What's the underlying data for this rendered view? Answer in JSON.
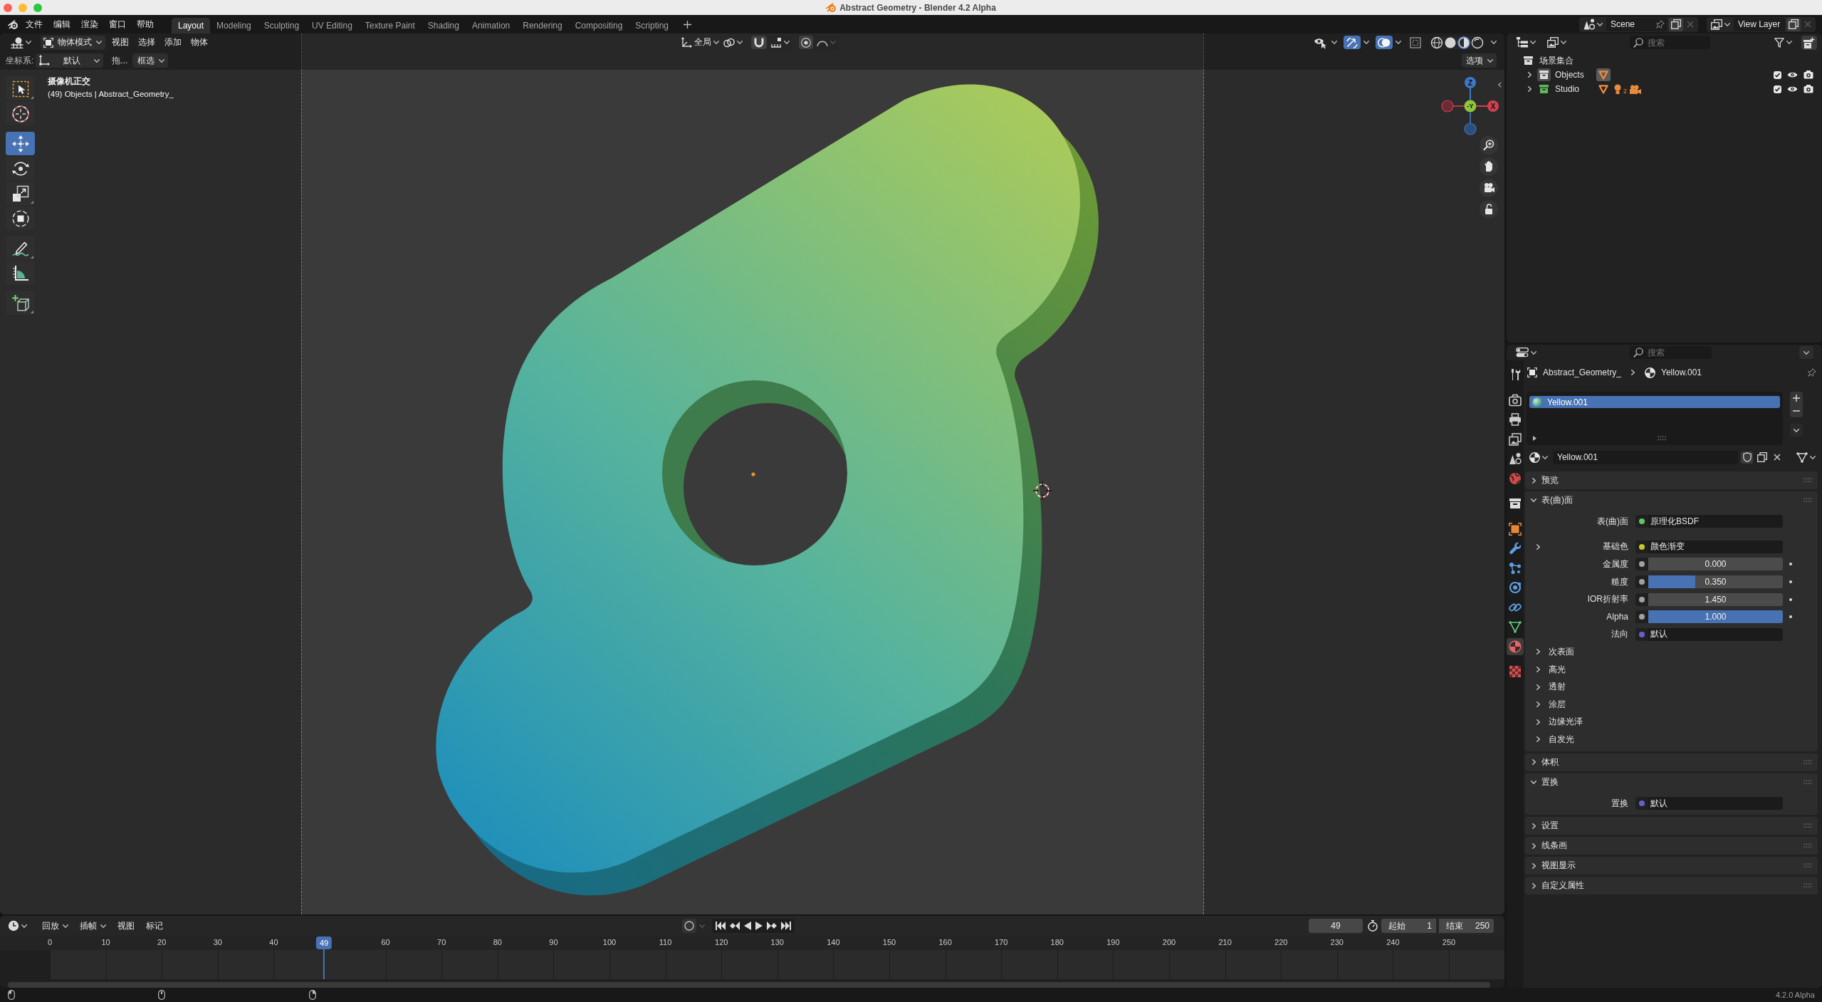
{
  "title_bar": {
    "title": "Abstract Geometry - Blender 4.2 Alpha"
  },
  "top_bar": {
    "menus": [
      "文件",
      "编辑",
      "渲染",
      "窗口",
      "帮助"
    ],
    "workspaces": [
      {
        "label": "Layout",
        "selected": true
      },
      {
        "label": "Modeling",
        "selected": false
      },
      {
        "label": "Sculpting",
        "selected": false
      },
      {
        "label": "UV Editing",
        "selected": false
      },
      {
        "label": "Texture Paint",
        "selected": false
      },
      {
        "label": "Shading",
        "selected": false
      },
      {
        "label": "Animation",
        "selected": false
      },
      {
        "label": "Rendering",
        "selected": false
      },
      {
        "label": "Compositing",
        "selected": false
      },
      {
        "label": "Scripting",
        "selected": false
      }
    ],
    "scene": "Scene",
    "view_layer": "View Layer"
  },
  "viewport": {
    "header": {
      "mode": "物体模式",
      "menus": [
        "视图",
        "选择",
        "添加",
        "物体"
      ],
      "orientation": "全局",
      "toggles": [
        {
          "kind": "visibility",
          "on": false
        },
        {
          "kind": "gizmo",
          "on": true
        },
        {
          "kind": "overlay",
          "on": true
        },
        {
          "kind": "xray",
          "on": false
        }
      ],
      "shading": [
        {
          "kind": "wireframe",
          "selected": false
        },
        {
          "kind": "solid",
          "selected": false
        },
        {
          "kind": "material",
          "selected": true
        },
        {
          "kind": "rendered",
          "selected": false
        }
      ]
    },
    "tool_settings": {
      "label": "坐标系:",
      "orientation": "默认",
      "drag": "拖...",
      "select": "框选",
      "options": "选项"
    },
    "tools": [
      {
        "kind": "select",
        "selected": false
      },
      {
        "kind": "cursor",
        "selected": false
      },
      {
        "kind": "move",
        "selected": true
      },
      {
        "kind": "rotate",
        "selected": false
      },
      {
        "kind": "scale",
        "selected": false
      },
      {
        "kind": "transform",
        "selected": false
      },
      {
        "kind": "annotate",
        "selected": false
      },
      {
        "kind": "measure",
        "selected": false
      },
      {
        "kind": "add",
        "selected": false
      }
    ],
    "info": {
      "view": "摄像机正交",
      "objects": "(49) Objects | Abstract_Geometry_"
    },
    "gizmo": [
      {
        "kind": "z",
        "label": "Z"
      },
      {
        "kind": "y",
        "label": "-Y"
      },
      {
        "kind": "x",
        "label": "X"
      }
    ]
  },
  "timeline": {
    "menus": [
      {
        "label": "回放",
        "dropdown": true
      },
      {
        "label": "插帧",
        "dropdown": true
      },
      {
        "label": "视图",
        "dropdown": false
      },
      {
        "label": "标记",
        "dropdown": false
      }
    ],
    "current_frame": "49",
    "start_label": "起始",
    "start": "1",
    "end_label": "结束",
    "end": "250",
    "ruler": [
      "0",
      "10",
      "20",
      "30",
      "40",
      "60",
      "70",
      "80",
      "90",
      "100",
      "110",
      "120",
      "130",
      "140",
      "150",
      "160",
      "170",
      "180",
      "190",
      "200",
      "210",
      "220",
      "230",
      "240",
      "250"
    ],
    "playhead": "49"
  },
  "outliner": {
    "search_placeholder": "搜索",
    "tree": [
      {
        "label": "场景集合",
        "children": [
          {
            "label": "Objects",
            "expanded": false,
            "active": true,
            "color": "#dcdcdc",
            "checked": true,
            "contents": [
              {
                "kind": "mesh",
                "selected": true
              }
            ]
          },
          {
            "label": "Studio",
            "expanded": false,
            "active": false,
            "color": "#5fb85a",
            "checked": true,
            "contents": [
              {
                "kind": "mesh",
                "selected": false
              },
              {
                "kind": "light",
                "count": "2",
                "selected": false
              },
              {
                "kind": "camera",
                "selected": false
              }
            ]
          }
        ]
      }
    ]
  },
  "properties": {
    "search_placeholder": "搜索",
    "tabs": [
      {
        "kind": "tool",
        "selected": false
      },
      {
        "kind": "render",
        "selected": false
      },
      {
        "kind": "output",
        "selected": false
      },
      {
        "kind": "viewlayer",
        "selected": false
      },
      {
        "kind": "scene",
        "selected": false
      },
      {
        "kind": "world",
        "selected": false
      },
      {
        "kind": "collection",
        "selected": false
      },
      {
        "kind": "object",
        "selected": false
      },
      {
        "kind": "modifier",
        "selected": false
      },
      {
        "kind": "particles",
        "selected": false
      },
      {
        "kind": "physics",
        "selected": false
      },
      {
        "kind": "constraints",
        "selected": false
      },
      {
        "kind": "data",
        "selected": false
      },
      {
        "kind": "material",
        "selected": true
      },
      {
        "kind": "texture",
        "selected": false
      }
    ],
    "breadcrumb": {
      "object": "Abstract_Geometry_",
      "material": "Yellow.001"
    },
    "material_slots": [
      {
        "label": "Yellow.001",
        "selected": true
      }
    ],
    "material_name": "Yellow.001",
    "panels": [
      {
        "title": "预览",
        "expanded": false
      },
      {
        "title": "表(曲)面",
        "expanded": true,
        "rows": [
          {
            "kind": "link",
            "label": "表(曲)面",
            "value": "原理化BSDF",
            "color": "#63c763",
            "expander": false
          },
          {
            "kind": "link",
            "label": "基础色",
            "value": "颜色渐变",
            "color": "#c7c729",
            "expander": true
          },
          {
            "kind": "slider",
            "label": "金属度",
            "value": "0.000",
            "level": 0,
            "color": "#a1a1a1",
            "expander": false
          },
          {
            "kind": "slider",
            "label": "糙度",
            "value": "0.350",
            "level": 0.35,
            "color": "#a1a1a1",
            "expander": false
          },
          {
            "kind": "number",
            "label": "IOR折射率",
            "value": "1.450",
            "color": "#a1a1a1",
            "expander": false
          },
          {
            "kind": "slider",
            "label": "Alpha",
            "value": "1.000",
            "level": 1,
            "color": "#a1a1a1",
            "expander": false
          },
          {
            "kind": "link",
            "label": "法向",
            "value": "默认",
            "color": "#6363c7",
            "expander": false
          }
        ],
        "subpanels": [
          {
            "title": "次表面",
            "expanded": false
          },
          {
            "title": "高光",
            "expanded": false
          },
          {
            "title": "透射",
            "expanded": false
          },
          {
            "title": "涂层",
            "expanded": false
          },
          {
            "title": "边缘光泽",
            "expanded": false
          },
          {
            "title": "自发光",
            "expanded": false
          }
        ]
      },
      {
        "title": "体积",
        "expanded": false
      },
      {
        "title": "置换",
        "expanded": true,
        "rows": [
          {
            "kind": "link",
            "label": "置换",
            "value": "默认",
            "color": "#6363c7",
            "expander": false
          }
        ]
      },
      {
        "title": "设置",
        "expanded": false
      },
      {
        "title": "线条画",
        "expanded": false
      },
      {
        "title": "视图显示",
        "expanded": false
      },
      {
        "title": "自定义属性",
        "expanded": false
      }
    ]
  },
  "status_bar": {
    "version": "4.2.0 Alpha"
  }
}
